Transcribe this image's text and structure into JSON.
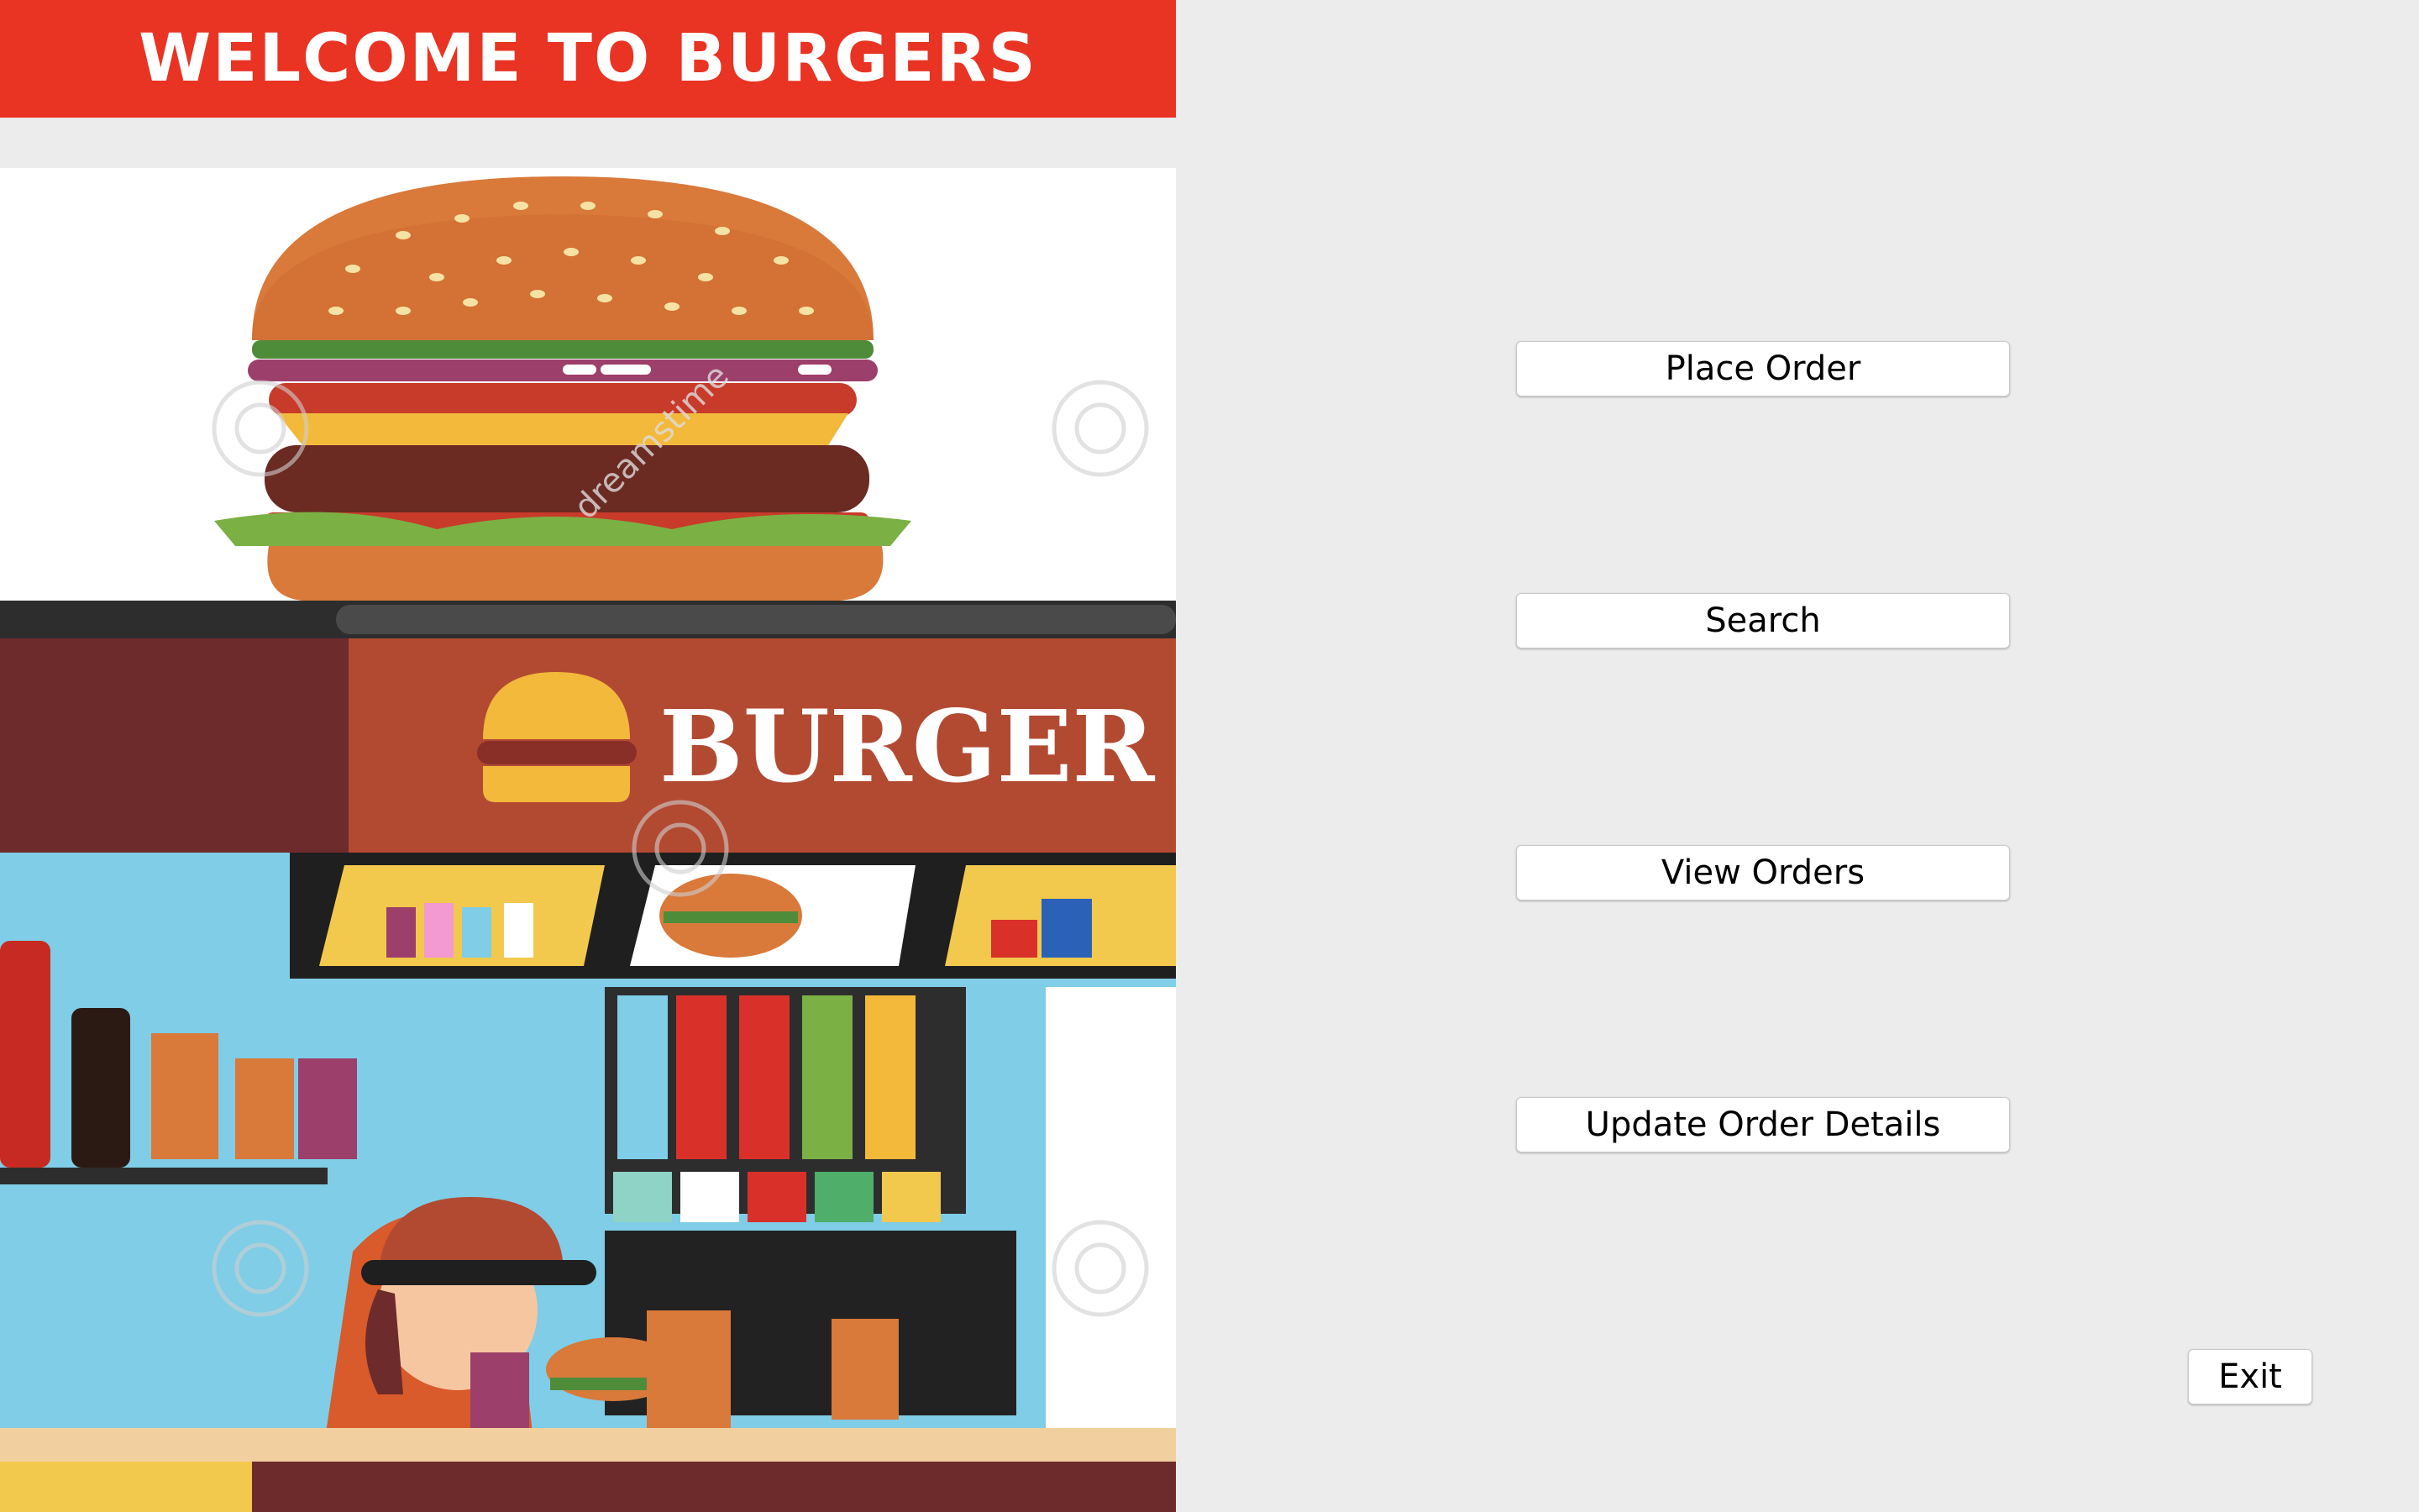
{
  "header": {
    "title": "WELCOME TO BURGERS"
  },
  "illustration": {
    "shop_sign": "BURGER",
    "watermark": "dreamstime"
  },
  "menu": {
    "place_order": "Place Order",
    "search": "Search",
    "view_orders": "View Orders",
    "update_order_details": "Update Order Details"
  },
  "exit_label": "Exit",
  "colors": {
    "banner": "#e93323",
    "background": "#ececec",
    "button_bg": "#ffffff"
  }
}
